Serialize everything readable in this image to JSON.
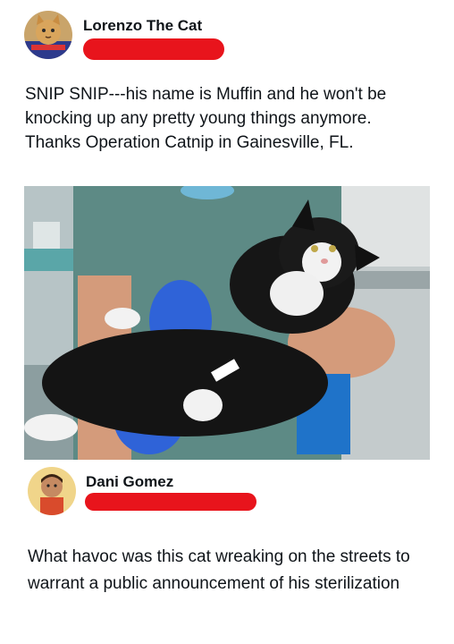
{
  "post1": {
    "author_name": "Lorenzo The Cat",
    "body": "SNIP SNIP---his name is Muffin and he won't be knocking up any pretty young things anymore. Thanks Operation Catnip in Gainesville, FL.",
    "image": "cat-photo"
  },
  "post2": {
    "author_name": "Dani Gomez",
    "body": "What havoc was this cat wreaking on the streets to warrant a public announcement of his sterilization"
  },
  "colors": {
    "redaction": "#e8141c",
    "text": "#0f1419"
  }
}
